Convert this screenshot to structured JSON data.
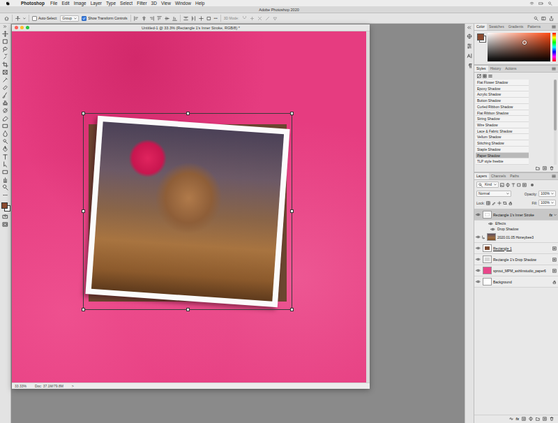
{
  "menubar": {
    "app": "Photoshop",
    "items": [
      "File",
      "Edit",
      "Image",
      "Layer",
      "Type",
      "Select",
      "Filter",
      "3D",
      "View",
      "Window",
      "Help"
    ]
  },
  "app_window": {
    "title": "Adobe Photoshop 2020"
  },
  "options_bar": {
    "auto_select": {
      "label": "Auto-Select:",
      "checked": false
    },
    "target": "Group",
    "transform_controls": {
      "label": "Show Transform Controls",
      "checked": true
    },
    "more": "•••",
    "mode_label": "3D Mode:"
  },
  "document": {
    "title": "Untitled-1 @ 33.3% (Rectangle 1's Inner Stroke, RGB/8) *",
    "zoom": "33.33%",
    "doc_info": "Doc: 37.1M/79.8M",
    "status_arrow": ">"
  },
  "color_panel": {
    "tabs": [
      {
        "label": "Color",
        "selected": true
      },
      {
        "label": "Swatches",
        "selected": false
      },
      {
        "label": "Gradients",
        "selected": false
      },
      {
        "label": "Patterns",
        "selected": false
      }
    ]
  },
  "styles_panel": {
    "tabs": [
      {
        "label": "Styles",
        "selected": true
      },
      {
        "label": "History",
        "selected": false
      },
      {
        "label": "Actions",
        "selected": false
      }
    ],
    "styles": [
      {
        "label": "Flat Flower Shadow",
        "selected": false
      },
      {
        "label": "Epoxy Shadow",
        "selected": false
      },
      {
        "label": "Acrylic Shadow",
        "selected": false
      },
      {
        "label": "Button Shadow",
        "selected": false
      },
      {
        "label": "Curled Ribbon Shadow",
        "selected": false
      },
      {
        "label": "Flat Ribbon Shadow",
        "selected": false
      },
      {
        "label": "String Shadow",
        "selected": false
      },
      {
        "label": "Wire Shadow",
        "selected": false
      },
      {
        "label": "Lace & Fabric Shadow",
        "selected": false
      },
      {
        "label": "Vellum Shadow",
        "selected": false
      },
      {
        "label": "Stitching Shadow",
        "selected": false
      },
      {
        "label": "Staple Shadow",
        "selected": false
      },
      {
        "label": "Paper Shadow",
        "selected": true
      },
      {
        "label": "TLP style freebie",
        "selected": false
      }
    ]
  },
  "layers_panel": {
    "tabs": [
      {
        "label": "Layers",
        "selected": true
      },
      {
        "label": "Channels",
        "selected": false
      },
      {
        "label": "Paths",
        "selected": false
      }
    ],
    "filter": "Kind",
    "blend_mode": "Normal",
    "opacity_label": "Opacity:",
    "opacity": "100%",
    "lock_label": "Lock:",
    "fill_label": "Fill:",
    "fill": "100%",
    "footer_fx": "fx",
    "layers": [
      {
        "name": "Rectangle 1's Inner Stroke",
        "kind": "stroke",
        "visible": true,
        "selected": true,
        "badge": "fx",
        "expanded": true,
        "clipped": false,
        "underlined": false,
        "smart": false,
        "locked": false
      },
      {
        "name": "Effects",
        "kind": "effects",
        "visible": true,
        "selected": false,
        "clipped": false,
        "underlined": false,
        "smart": false,
        "locked": false
      },
      {
        "name": "Drop Shadow",
        "kind": "effect",
        "visible": true,
        "selected": false,
        "clipped": false,
        "underlined": false,
        "smart": false,
        "locked": false
      },
      {
        "name": "2020.01.05 Honeybee3",
        "kind": "photo",
        "visible": true,
        "selected": false,
        "clipped": true,
        "underlined": false,
        "smart": false,
        "locked": false
      },
      {
        "name": "Rectangle 1",
        "kind": "shape",
        "visible": true,
        "selected": false,
        "clipped": false,
        "underlined": true,
        "smart": true,
        "locked": false
      },
      {
        "name": "Rectangle 1's Drop Shadow",
        "kind": "shadow",
        "visible": true,
        "selected": false,
        "clipped": false,
        "underlined": false,
        "smart": true,
        "locked": false
      },
      {
        "name": "sprout_MPM_ashlinstudio_paper6",
        "kind": "paper",
        "visible": true,
        "selected": false,
        "clipped": false,
        "underlined": false,
        "smart": true,
        "locked": false
      },
      {
        "name": "Background",
        "kind": "background",
        "visible": true,
        "selected": false,
        "clipped": false,
        "underlined": false,
        "smart": false,
        "locked": true
      }
    ]
  }
}
